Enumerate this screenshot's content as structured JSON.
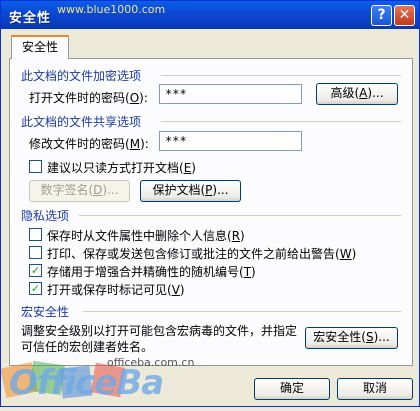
{
  "window": {
    "title": "安全性",
    "watermark": "www.blue1000.com"
  },
  "tab": {
    "label": "安全性"
  },
  "encryption": {
    "group_title": "此文档的文件加密选项",
    "open_label": "打开文件时的密码",
    "open_key": "O",
    "open_value": "***",
    "advanced_button": "高级",
    "advanced_key": "A"
  },
  "sharing": {
    "group_title": "此文档的文件共享选项",
    "modify_label": "修改文件时的密码",
    "modify_key": "M",
    "modify_value": "***",
    "readonly_label": "建议以只读方式打开文档",
    "readonly_key": "E",
    "digital_signature_button": "数字签名",
    "digital_signature_key": "D",
    "protect_button": "保护文档",
    "protect_key": "P"
  },
  "privacy": {
    "group_title": "隐私选项",
    "options": [
      {
        "label": "保存时从文件属性中删除个人信息",
        "key": "R",
        "checked": false
      },
      {
        "label": "打印、保存或发送包含修订或批注的文件之前给出警告",
        "key": "W",
        "checked": false
      },
      {
        "label": "存储用于增强合并精确性的随机编号",
        "key": "T",
        "checked": true
      },
      {
        "label": "打开或保存时标记可见",
        "key": "V",
        "checked": true
      }
    ]
  },
  "macro": {
    "group_title": "宏安全性",
    "description": "调整安全级别以打开可能包含宏病毒的文件，并指定可信任的宏创建者姓名。",
    "button": "宏安全性",
    "button_key": "S"
  },
  "footer": {
    "ok": "确定",
    "cancel": "取消",
    "logo": "OfficeBa",
    "logo_url": "officeba.com.cn"
  },
  "colors": {
    "titlebar": "#0a49d6",
    "group_title": "#1c3a9f",
    "check": "#21a121"
  }
}
